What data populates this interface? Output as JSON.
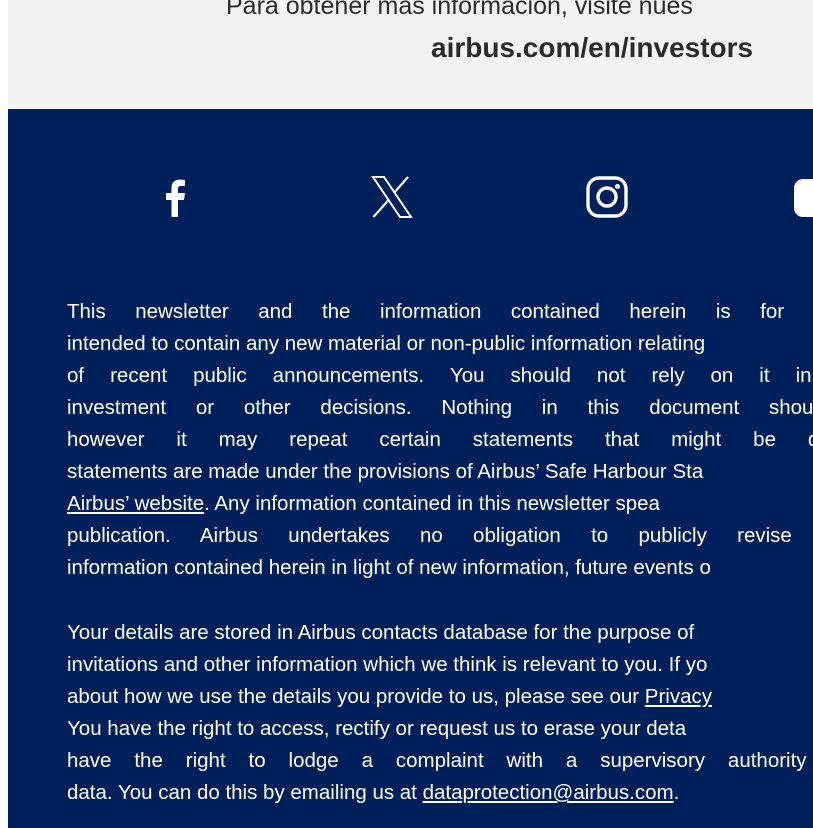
{
  "top_banner": {
    "line1": "Para obtener más información, visite nues",
    "line2": "airbus.com/en/investors"
  },
  "social": {
    "facebook": "facebook-icon",
    "x": "x-icon",
    "instagram": "instagram-icon",
    "youtube": "youtube-icon"
  },
  "disclaimer": {
    "line1": "This newsletter and the information contained herein is for informa",
    "line2": "intended to contain any new material or non-public information relating",
    "line3": "of recent public announcements. You should not rely on it in conn",
    "line4": "investment or other decisions. Nothing in this document should be",
    "line5": "however it may repeat certain statements that might be deemed",
    "line6": "statements are made under the provisions of Airbus’ Safe Harbour Sta",
    "line7_link": "Airbus’ website",
    "line7_rest": ". Any information contained in this newsletter spea",
    "line8": "publication. Airbus undertakes no obligation to publicly revise or u",
    "line9": "information contained herein in light of new information, future events o"
  },
  "privacy": {
    "line1": "Your details are stored in Airbus contacts database for the purpose of",
    "line2": "invitations and other information which we think is relevant to you. If yo",
    "line3_text": "about how we use the details you provide to us, please see our ",
    "line3_link": "Privacy",
    "line4": "You have the right to access, rectify or request us to erase your deta",
    "line5": "have the right to lodge a complaint with a supervisory authority or o",
    "line6_text": "data. You can do this by emailing us at ",
    "line6_link": "dataprotection@airbus.com",
    "line6_end": "."
  }
}
